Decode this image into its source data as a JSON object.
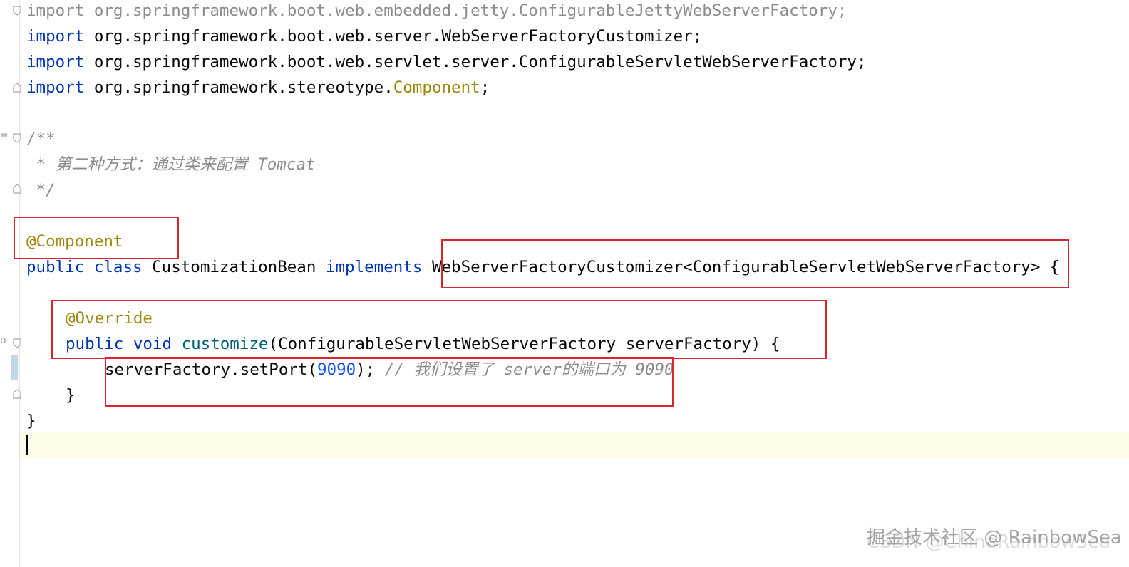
{
  "editor": {
    "lines": {
      "l1": {
        "kw": "import",
        "rest": " org.springframework.boot.web.embedded.jetty.ConfigurableJettyWebServerFactory;"
      },
      "l2": {
        "kw": "import",
        "rest": " org.springframework.boot.web.server.WebServerFactoryCustomizer;"
      },
      "l3": {
        "kw": "import",
        "rest": " org.springframework.boot.web.servlet.server.ConfigurableServletWebServerFactory;"
      },
      "l4": {
        "kw": "import",
        "pre": " org.springframework.stereotype.",
        "ann": "Component",
        "post": ";"
      },
      "l6": "/**",
      "l7": " * 第二种方式：通过类来配置 Tomcat",
      "l8": " */",
      "l10": "@Component",
      "l11": {
        "kw1": "public",
        "kw2": "class",
        "name": "CustomizationBean",
        "kw3": "implements",
        "type": "WebServerFactoryCustomizer<ConfigurableServletWebServerFactory>",
        "brace": " {"
      },
      "l13": "@Override",
      "l14": {
        "kw1": "public",
        "kw2": "void",
        "method": "customize",
        "params": "(ConfigurableServletWebServerFactory serverFactory) {"
      },
      "l15": {
        "call": "serverFactory.setPort(",
        "num": "9090",
        "close": ");",
        "comment": " // 我们设置了 server的端口为 9090"
      },
      "l16": "}",
      "l17": "}"
    },
    "gutter_marks": {
      "m1": "=",
      "m2": "o"
    }
  },
  "watermark": {
    "main": "掘金技术社区 @ RainbowSea",
    "shadow": "CSDN @ChinaRainbowSea"
  },
  "colors": {
    "keyword": "#0033b3",
    "annotation": "#9e880d",
    "comment": "#8c8c8c",
    "number": "#1750eb",
    "highlight_box": "#d9252f",
    "current_line": "#fefbe8"
  }
}
